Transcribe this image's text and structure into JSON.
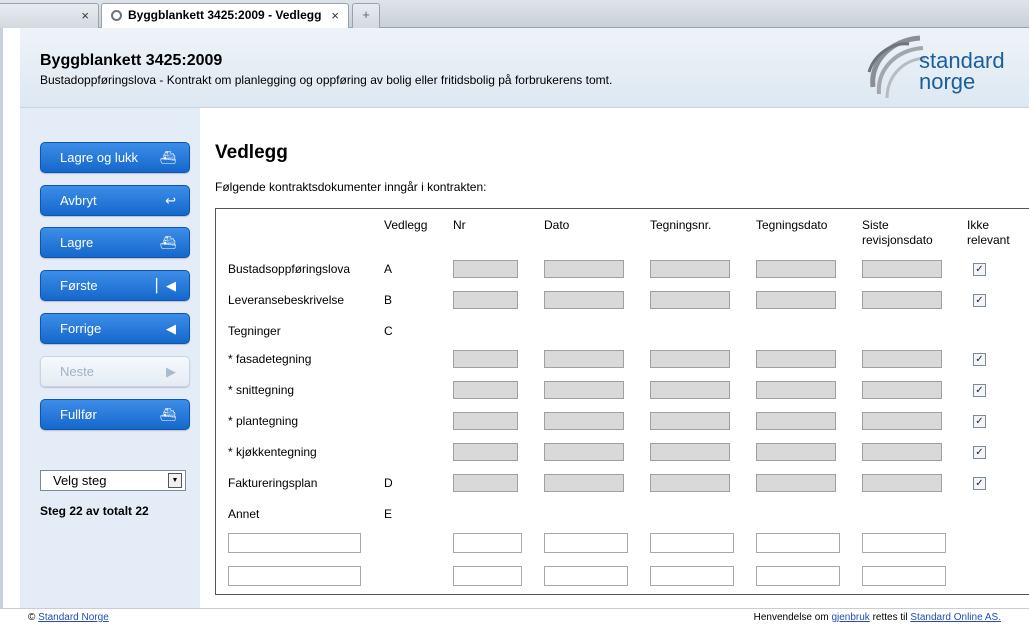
{
  "browser": {
    "tabs": [
      {
        "label": "",
        "close": "×"
      },
      {
        "label": "Byggblankett 3425:2009 - Vedlegg",
        "close": "×"
      }
    ],
    "new_tab": "+"
  },
  "header": {
    "title": "Byggblankett 3425:2009",
    "description": "Bustadoppføringslova - Kontrakt om planlegging og oppføring av bolig eller fritidsbolig på forbrukerens tomt.",
    "logo_line1": "standard",
    "logo_line2": "norge"
  },
  "sidebar": {
    "buttons": [
      {
        "label": "Lagre og lukk",
        "icon": "save-close-icon"
      },
      {
        "label": "Avbryt",
        "icon": "undo-icon"
      },
      {
        "label": "Lagre",
        "icon": "save-icon"
      },
      {
        "label": "Første",
        "icon": "first-icon"
      },
      {
        "label": "Forrige",
        "icon": "previous-icon"
      },
      {
        "label": "Neste",
        "icon": "next-icon",
        "disabled": true
      },
      {
        "label": "Fullfør",
        "icon": "finish-icon"
      }
    ],
    "select": {
      "value": "Velg steg"
    },
    "step_text": "Steg 22 av totalt 22"
  },
  "main": {
    "title": "Vedlegg",
    "intro": "Følgende kontraktsdokumenter inngår i kontrakten:",
    "columns": [
      "Vedlegg",
      "Nr",
      "Dato",
      "Tegningsnr.",
      "Tegningsdato",
      "Siste revisjonsdato",
      "Ikke relevant"
    ],
    "rows": [
      {
        "name": "Bustadsoppføringslova",
        "code": "A",
        "checked": true
      },
      {
        "name": "Leveransebeskrivelse",
        "code": "B",
        "checked": true
      },
      {
        "name": "Tegninger",
        "code": "C"
      },
      {
        "name": "* fasadetegning",
        "code": "",
        "checked": true
      },
      {
        "name": "* snittegning",
        "code": "",
        "checked": true
      },
      {
        "name": "* plantegning",
        "code": "",
        "checked": true
      },
      {
        "name": "* kjøkkentegning",
        "code": "",
        "checked": true
      },
      {
        "name": "Faktureringsplan",
        "code": "D",
        "checked": true
      },
      {
        "name": "Annet",
        "code": "E"
      }
    ],
    "check_mark": "✓"
  },
  "footer": {
    "copyright": "©",
    "company_link": "Standard Norge",
    "text_before": "Henvendelse om",
    "reuse_link": "gjenbruk",
    "text_middle": "rettes til",
    "online_link": "Standard Online AS."
  }
}
